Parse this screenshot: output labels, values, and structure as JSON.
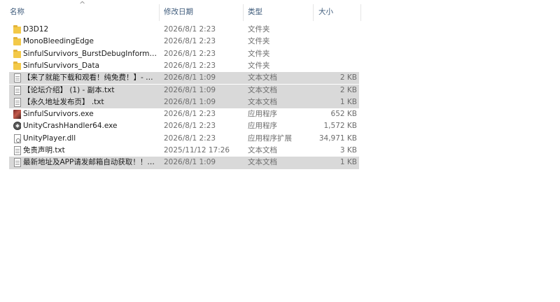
{
  "columns": {
    "name": "名称",
    "date": "修改日期",
    "type": "类型",
    "size": "大小"
  },
  "sort_indicator": "^",
  "files": [
    {
      "icon": "folder-icon",
      "name": "D3D12",
      "date": "2026/8/1 2:23",
      "type": "文件夹",
      "size": "",
      "selected": false
    },
    {
      "icon": "folder-icon",
      "name": "MonoBleedingEdge",
      "date": "2026/8/1 2:23",
      "type": "文件夹",
      "size": "",
      "selected": false
    },
    {
      "icon": "folder-icon",
      "name": "SinfulSurvivors_BurstDebugInformati...",
      "date": "2026/8/1 2:23",
      "type": "文件夹",
      "size": "",
      "selected": false
    },
    {
      "icon": "folder-icon",
      "name": "SinfulSurvivors_Data",
      "date": "2026/8/1 2:23",
      "type": "文件夹",
      "size": "",
      "selected": false
    },
    {
      "icon": "text-document-icon",
      "name": "【来了就能下载和观看！纯免费！】- 副...",
      "date": "2026/8/1 1:09",
      "type": "文本文档",
      "size": "2 KB",
      "selected": true
    },
    {
      "icon": "text-document-icon",
      "name": "【论坛介绍】 (1) - 副本.txt",
      "date": "2026/8/1 1:09",
      "type": "文本文档",
      "size": "2 KB",
      "selected": true
    },
    {
      "icon": "text-document-icon",
      "name": "【永久地址发布页】 .txt",
      "date": "2026/8/1 1:09",
      "type": "文本文档",
      "size": "1 KB",
      "selected": true
    },
    {
      "icon": "game-app-icon",
      "name": "SinfulSurvivors.exe",
      "date": "2026/8/1 2:23",
      "type": "应用程序",
      "size": "652 KB",
      "selected": false
    },
    {
      "icon": "unity-icon",
      "name": "UnityCrashHandler64.exe",
      "date": "2026/8/1 2:23",
      "type": "应用程序",
      "size": "1,572 KB",
      "selected": false
    },
    {
      "icon": "dll-file-icon",
      "name": "UnityPlayer.dll",
      "date": "2026/8/1 2:23",
      "type": "应用程序扩展",
      "size": "34,971 KB",
      "selected": false
    },
    {
      "icon": "text-document-icon",
      "name": "免责声明.txt",
      "date": "2025/11/12 17:26",
      "type": "文本文档",
      "size": "3 KB",
      "selected": false
    },
    {
      "icon": "text-document-icon",
      "name": "最新地址及APP请发邮箱自动获取！！！...",
      "date": "2026/8/1 1:09",
      "type": "文本文档",
      "size": "1 KB",
      "selected": true
    }
  ]
}
